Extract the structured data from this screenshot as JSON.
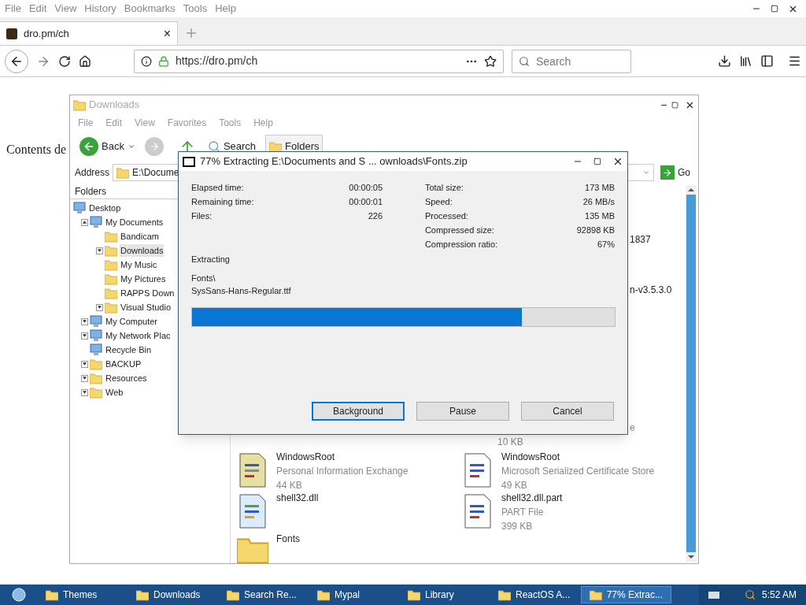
{
  "browser": {
    "menu": [
      "File",
      "Edit",
      "View",
      "History",
      "Bookmarks",
      "Tools",
      "Help"
    ],
    "tab": {
      "title": "dro.pm/ch",
      "close": "×"
    },
    "url": "https://dro.pm/ch",
    "search": {
      "placeholder": "Search"
    },
    "page_text": "Contents de"
  },
  "explorer": {
    "title": "Downloads",
    "menu": [
      "File",
      "Edit",
      "View",
      "Favorites",
      "Tools",
      "Help"
    ],
    "toolbar": [
      {
        "label": "Back",
        "kind": "back",
        "selected": false
      },
      {
        "label": "Search",
        "kind": "search",
        "selected": false
      },
      {
        "label": "Folders",
        "kind": "folders",
        "selected": true
      }
    ],
    "address": {
      "label": "Address",
      "value": "E:\\Docume",
      "go": "Go"
    },
    "folders_header": "Folders",
    "tree": [
      {
        "label": "Desktop",
        "kind": "special",
        "selected": false,
        "children": [
          {
            "label": "My Documents",
            "kind": "special",
            "selected": false,
            "expanded": true,
            "children": [
              {
                "label": "Bandicam",
                "kind": "folder",
                "selected": false
              },
              {
                "label": "Downloads",
                "kind": "folder",
                "selected": true,
                "expanded": false
              },
              {
                "label": "My Music",
                "kind": "folder",
                "selected": false
              },
              {
                "label": "My Pictures",
                "kind": "folder",
                "selected": false
              },
              {
                "label": "RAPPS Down",
                "kind": "folder",
                "selected": false
              },
              {
                "label": "Visual Studio",
                "kind": "folder",
                "selected": false,
                "expanded": false
              }
            ]
          },
          {
            "label": "My Computer",
            "kind": "special",
            "selected": false,
            "expanded": false
          },
          {
            "label": "My Network Plac",
            "kind": "special",
            "selected": false,
            "expanded": false
          },
          {
            "label": "Recycle Bin",
            "kind": "special",
            "selected": false
          },
          {
            "label": "BACKUP",
            "kind": "folder",
            "selected": false,
            "expanded": false
          },
          {
            "label": "Resources",
            "kind": "folder",
            "selected": false,
            "expanded": false
          },
          {
            "label": "Web",
            "kind": "folder",
            "selected": false,
            "expanded": false
          }
        ]
      }
    ],
    "fragments": [
      "1837",
      "n-v3.5.3.0",
      "e",
      "10 KB"
    ],
    "files": [
      {
        "name": "WindowsRoot",
        "type": "Personal Information Exchange",
        "size": "44 KB",
        "kind": "certificate"
      },
      {
        "name": "WindowsRoot",
        "type": "Microsoft Serialized Certificate Store",
        "size": "49 KB",
        "kind": "document"
      },
      {
        "name": "shell32.dll",
        "kind": "dll"
      },
      {
        "name": "shell32.dll.part",
        "type": "PART File",
        "size": "399 KB",
        "kind": "part"
      },
      {
        "name": "Fonts",
        "kind": "folder"
      }
    ]
  },
  "dialog": {
    "title": "77% Extracting E:\\Documents and S ... ownloads\\Fonts.zip",
    "left_stats": [
      {
        "label": "Elapsed time:",
        "value": "00:00:05"
      },
      {
        "label": "Remaining time:",
        "value": "00:00:01"
      },
      {
        "label": "Files:",
        "value": "226"
      }
    ],
    "right_stats": [
      {
        "label": "Total size:",
        "value": "173 MB"
      },
      {
        "label": "Speed:",
        "value": "26 MB/s"
      },
      {
        "label": "Processed:",
        "value": "135 MB"
      },
      {
        "label": "Compressed size:",
        "value": "92898 KB"
      },
      {
        "label": "Compression ratio:",
        "value": "67%"
      }
    ],
    "status": "Extracting",
    "path": "Fonts\\",
    "file": "SysSans-Hans-Regular.ttf",
    "progress": {
      "level": 0.78
    },
    "buttons": [
      {
        "label": "Background",
        "selected": true
      },
      {
        "label": "Pause",
        "selected": false
      },
      {
        "label": "Cancel",
        "selected": false
      }
    ]
  },
  "taskbar": {
    "items": [
      {
        "label": "Themes",
        "selected": false
      },
      {
        "label": "Downloads",
        "selected": false
      },
      {
        "label": "Search Re...",
        "selected": false
      },
      {
        "label": "Mypal",
        "selected": false
      },
      {
        "label": "Library",
        "selected": false
      },
      {
        "label": "ReactOS A...",
        "selected": false
      },
      {
        "label": "77% Extrac...",
        "selected": true
      }
    ],
    "clock": "5:52 AM"
  }
}
